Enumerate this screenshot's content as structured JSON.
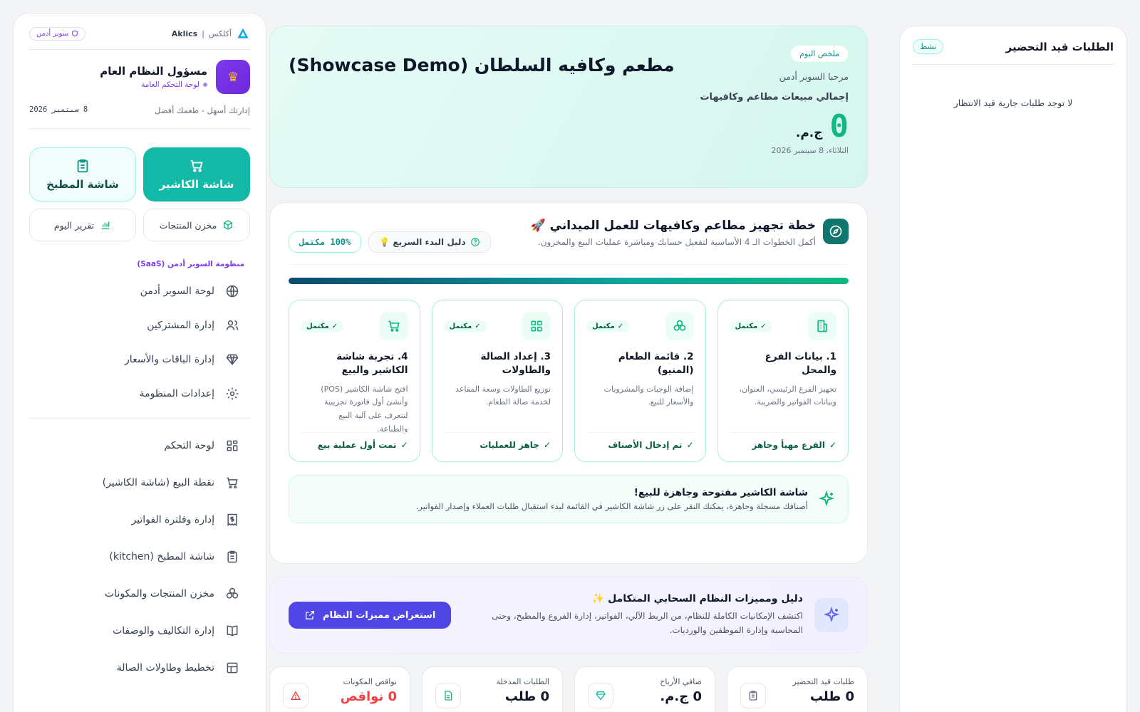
{
  "sidebar": {
    "brand_name": "Aklics",
    "brand_arabic": "أكلكس",
    "role_pill": "سوبر أدمن",
    "user_name": "مسؤول النظام العام",
    "user_sub": "لوحة التحكم العامة",
    "slogan": "إدارتك أسهل - طعمك أفضل",
    "date": "8 سبتمبر 2026",
    "quick_actions": {
      "cashier": "شاشة الكاشير",
      "kitchen": "شاشة المطبخ",
      "products": "مخزن المنتجات",
      "report": "تقرير اليوم"
    },
    "saas_label": "منظومة السوبر أدمن (SaaS)",
    "saas_items": [
      {
        "label": "لوحة السوبر أدمن",
        "icon": "globe-icon"
      },
      {
        "label": "إدارة المشتركين",
        "icon": "users-icon"
      },
      {
        "label": "إدارة الباقات والأسعار",
        "icon": "diamond-icon"
      },
      {
        "label": "إعدادات المنظومة",
        "icon": "gear-icon"
      }
    ],
    "main_items": [
      {
        "label": "لوحة التحكم",
        "icon": "grid-icon"
      },
      {
        "label": "نقطة البيع (شاشة الكاشير)",
        "icon": "cart-icon"
      },
      {
        "label": "إدارة وفلترة الفواتير",
        "icon": "receipt-icon"
      },
      {
        "label": "شاشة المطبخ (kitchen)",
        "icon": "clipboard-icon"
      },
      {
        "label": "مخزن المنتجات والمكونات",
        "icon": "boxes-icon"
      },
      {
        "label": "إدارة التكاليف والوصفات",
        "icon": "book-icon"
      },
      {
        "label": "تخطيط وطاولات الصالة",
        "icon": "layout-icon"
      }
    ]
  },
  "hero": {
    "badge": "ملخص اليوم",
    "title": "مطعم وكافيه السلطان (Showcase Demo)",
    "greeting": "مرحبا السوبر أدمن",
    "sales_label": "إجمالي مبيعات مطاعم وكافيهات",
    "amount": "0",
    "currency": "ج.م.",
    "date": "الثلاثاء، 8 سبتمبر 2026"
  },
  "setup": {
    "title": "خطة تجهيز مطاعم وكافيهات للعمل الميداني 🚀",
    "subtitle": "أكمل الخطوات الـ 4 الأساسية لتفعيل حسابك ومباشرة عمليات البيع والمخزون.",
    "guide_button": "دليل البدء السريع 💡",
    "complete_badge": "100% مكتمل",
    "progress": 1.0,
    "done_label": "مكتمل",
    "steps": [
      {
        "title": "1. بيانات الفرع والمحل",
        "desc": "تجهيز الفرع الرئيسي، العنوان، وبيانات الفواتير والضريبة.",
        "foot": "الفرع مهيأ وجاهز",
        "icon": "building-icon"
      },
      {
        "title": "2. قائمة الطعام (المنيو)",
        "desc": "إضافة الوجبات والمشروبات والأسعار للبيع.",
        "foot": "تم إدخال الأصناف",
        "icon": "boxes-icon"
      },
      {
        "title": "3. إعداد الصالة والطاولات",
        "desc": "توزيع الطاولات وسعة المقاعد لخدمة صالة الطعام.",
        "foot": "جاهز للعمليات",
        "icon": "grid-icon"
      },
      {
        "title": "4. تجربة شاشة الكاشير والبيع",
        "desc": "افتح شاشة الكاشير (POS) وأنشئ أول فاتورة تجريبية لتتعرف على آلية البيع والطباعة.",
        "foot": "تمت أول عملية بيع",
        "icon": "cart-icon"
      }
    ],
    "banner_title": "شاشة الكاشير مفتوحة وجاهزة للبيع!",
    "banner_text": "أصنافك مسجلة وجاهزة، يمكنك النقر على زر شاشة الكاشير في القائمة لبدء استقبال طلبات العملاء وإصدار الفواتير."
  },
  "features": {
    "title": "دليل ومميزات النظام السحابي المتكامل ✨",
    "text": "اكتشف الإمكانيات الكاملة للنظام، من الربط الآلي، الفواتير، إدارة الفروع والمطبخ، وحتى المحاسبة وإدارة الموظفين والورديات.",
    "button": "استعراض مميزات النظام"
  },
  "kpis": [
    {
      "label": "طلبات قيد التحضير",
      "value": "0 طلب",
      "icon": "clipboard-icon"
    },
    {
      "label": "صافي الأرباح",
      "value": "0 ج.م.",
      "icon": "diamond-icon"
    },
    {
      "label": "الطلبات المدخلة",
      "value": "0 طلب",
      "icon": "file-icon"
    },
    {
      "label": "نواقص المكونات",
      "value": "0 نواقص",
      "icon": "alert-icon"
    }
  ],
  "orders": {
    "title": "الطلبات قيد التحضير",
    "status": "نشط",
    "empty": "لا توجد طلبات جارية قيد الانتظار"
  },
  "colors": {
    "accent": "#14b8a6",
    "brand_purple": "#7c3aed",
    "primary_button": "#4f46e5",
    "danger": "#ef4444"
  }
}
